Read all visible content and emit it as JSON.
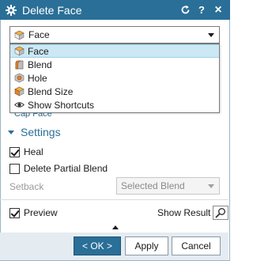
{
  "dialog": {
    "title": "Delete Face",
    "title_icons": [
      "gear-icon",
      "reset-icon",
      "help-icon",
      "close-icon"
    ],
    "help_glyph": "?",
    "close_glyph": "×",
    "accent_color": "#2a6f97"
  },
  "type_select": {
    "selected": "Face",
    "options": [
      {
        "label": "Face",
        "icon": "face-icon",
        "selected": true
      },
      {
        "label": "Blend",
        "icon": "blend-icon",
        "selected": false
      },
      {
        "label": "Hole",
        "icon": "hole-icon",
        "selected": false
      },
      {
        "label": "Blend Size",
        "icon": "blend-size-icon",
        "selected": false
      },
      {
        "label": "Show Shortcuts",
        "icon": "eye-icon",
        "selected": false
      }
    ],
    "partially_hidden_label": "Cap Face"
  },
  "settings": {
    "header": "Settings",
    "heal_label": "Heal",
    "heal_checked": true,
    "delete_partial_blend_label": "Delete Partial Blend",
    "delete_partial_blend_checked": false,
    "setback_label": "Setback",
    "setback_value": "Selected Blend"
  },
  "preview": {
    "label": "Preview",
    "checked": true,
    "show_result_label": "Show Result"
  },
  "footer": {
    "ok_label": "< OK >",
    "apply_label": "Apply",
    "cancel_label": "Cancel"
  }
}
